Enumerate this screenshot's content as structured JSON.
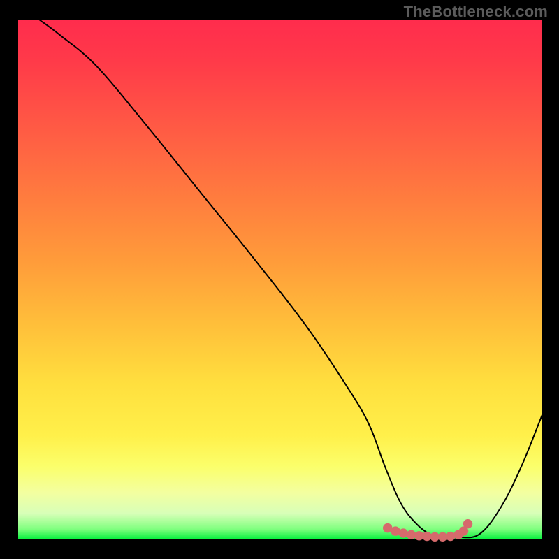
{
  "watermark": "TheBottleneck.com",
  "chart_data": {
    "type": "line",
    "title": "",
    "xlabel": "",
    "ylabel": "",
    "xlim": [
      0,
      100
    ],
    "ylim": [
      0,
      100
    ],
    "grid": false,
    "legend": false,
    "series": [
      {
        "name": "bottleneck-curve",
        "x": [
          4,
          8,
          15,
          25,
          35,
          45,
          55,
          63,
          67,
          70,
          73,
          76,
          79,
          82,
          84,
          88,
          92,
          96,
          100
        ],
        "y": [
          100,
          97,
          91,
          79,
          66.5,
          54,
          41,
          29,
          22,
          14,
          7,
          3,
          0.8,
          0.4,
          0.4,
          1,
          6,
          14,
          24
        ]
      }
    ],
    "markers": {
      "name": "flat-region-dots",
      "color": "#d66a6c",
      "x": [
        70.5,
        72,
        73.5,
        75,
        76.5,
        78,
        79.5,
        81,
        82.5,
        84,
        85,
        85.8
      ],
      "y": [
        2.2,
        1.6,
        1.2,
        0.9,
        0.7,
        0.6,
        0.5,
        0.5,
        0.6,
        0.9,
        1.6,
        3.0
      ]
    }
  }
}
